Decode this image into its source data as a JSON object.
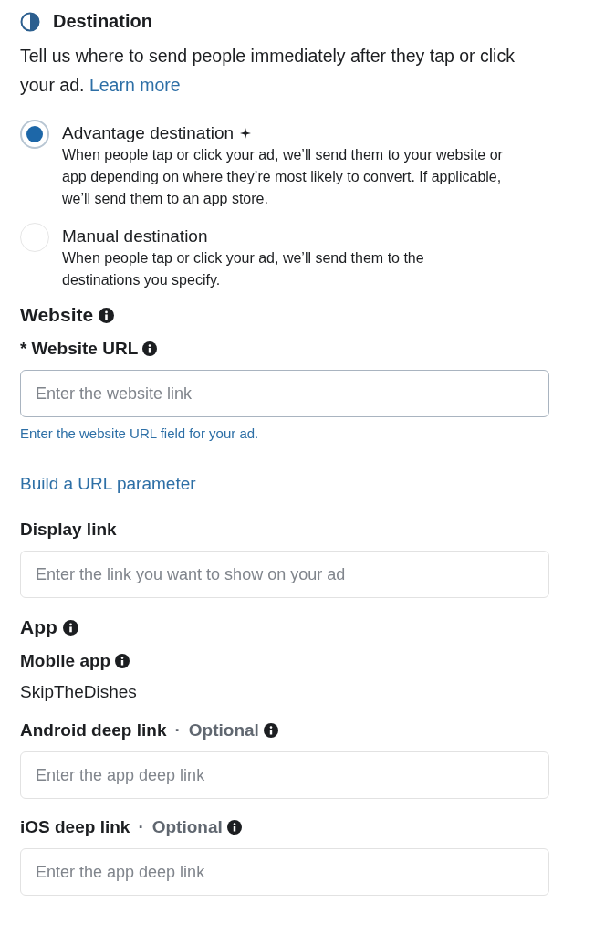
{
  "header": {
    "title": "Destination",
    "description": "Tell us where to send people immediately after they tap or click your ad.",
    "link": "Learn more"
  },
  "options": [
    {
      "label": "Advantage destination",
      "sparkle": true,
      "description": "When people tap or click your ad, we’ll send them to your website or app depending on where they’re most likely to convert. If applicable, we’ll send them to an app store.",
      "selected": true
    },
    {
      "label": "Manual destination",
      "sparkle": false,
      "description": "When people tap or click your ad, we’ll send them to the destinations you specify.",
      "selected": false
    }
  ],
  "sections": [
    {
      "title": "Website",
      "info": true,
      "items": [
        {
          "kind": "field",
          "required_mark": "*",
          "label": "Website URL",
          "info": true,
          "placeholder": "Enter the website link",
          "focused": true,
          "helper": "Enter the website URL field for your ad."
        },
        {
          "kind": "link",
          "text": "Build a URL parameter"
        },
        {
          "kind": "field",
          "label": "Display link",
          "info": false,
          "placeholder": "Enter the link you want to show on your ad",
          "focused": false
        }
      ]
    },
    {
      "title": "App",
      "info": true,
      "items": [
        {
          "kind": "value",
          "label": "Mobile app",
          "info": true,
          "value": "SkipTheDishes"
        },
        {
          "kind": "field",
          "label": "Android deep link",
          "separator": "·",
          "optional": "Optional",
          "info": true,
          "placeholder": "Enter the app deep link",
          "focused": false
        },
        {
          "kind": "field",
          "label": "iOS deep link",
          "separator": "·",
          "optional": "Optional",
          "info": true,
          "placeholder": "Enter the app deep link",
          "focused": false
        }
      ]
    }
  ]
}
